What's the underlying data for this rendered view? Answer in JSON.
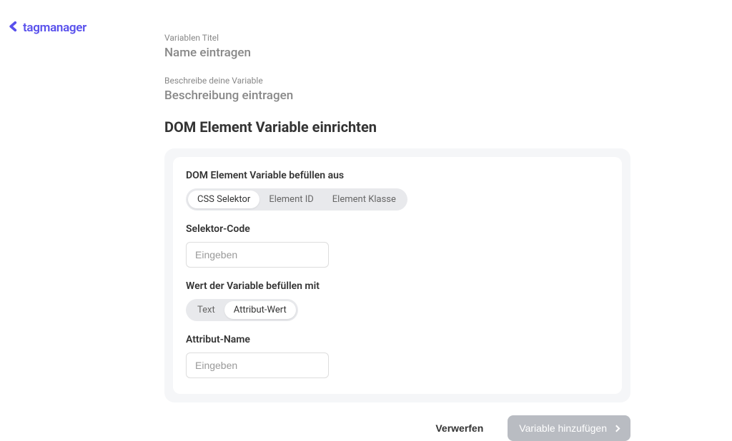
{
  "logo": {
    "text": "tagmanager"
  },
  "form": {
    "titleLabel": "Variablen Titel",
    "titleValue": "Name eintragen",
    "descriptionLabel": "Beschreibe deine Variable",
    "descriptionValue": "Beschreibung eintragen"
  },
  "section": {
    "title": "DOM Element Variable einrichten",
    "fillFromLabel": "DOM Element Variable befüllen aus",
    "selectorTypes": {
      "css": "CSS Selektor",
      "elementId": "Element ID",
      "elementClass": "Element Klasse"
    },
    "selectorCodeLabel": "Selektor-Code",
    "selectorCodePlaceholder": "Eingeben",
    "fillWithLabel": "Wert der Variable befüllen mit",
    "valueTypes": {
      "text": "Text",
      "attributeValue": "Attribut-Wert"
    },
    "attributeNameLabel": "Attribut-Name",
    "attributeNamePlaceholder": "Eingeben"
  },
  "actions": {
    "discard": "Verwerfen",
    "add": "Variable hinzufügen"
  }
}
